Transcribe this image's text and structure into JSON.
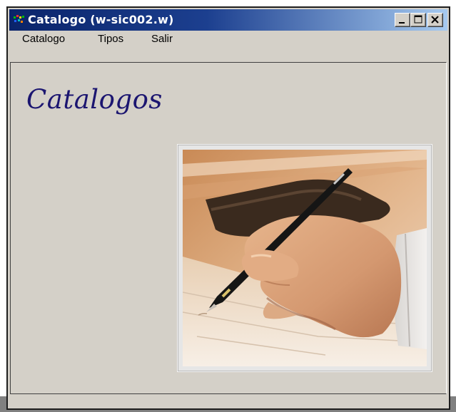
{
  "window": {
    "title": "Catalogo (w-sic002.w)"
  },
  "menu": {
    "items": [
      {
        "label": "Catalogo"
      },
      {
        "label": "Tipos"
      },
      {
        "label": "Salir"
      }
    ]
  },
  "main": {
    "heading": "Catalogos",
    "image_icon": "photo-hand-writing-with-pen"
  },
  "colors": {
    "titlebar_start": "#0a246a",
    "titlebar_end": "#a6caf0",
    "window_bg": "#d4d0c8",
    "heading": "#1b1570"
  }
}
